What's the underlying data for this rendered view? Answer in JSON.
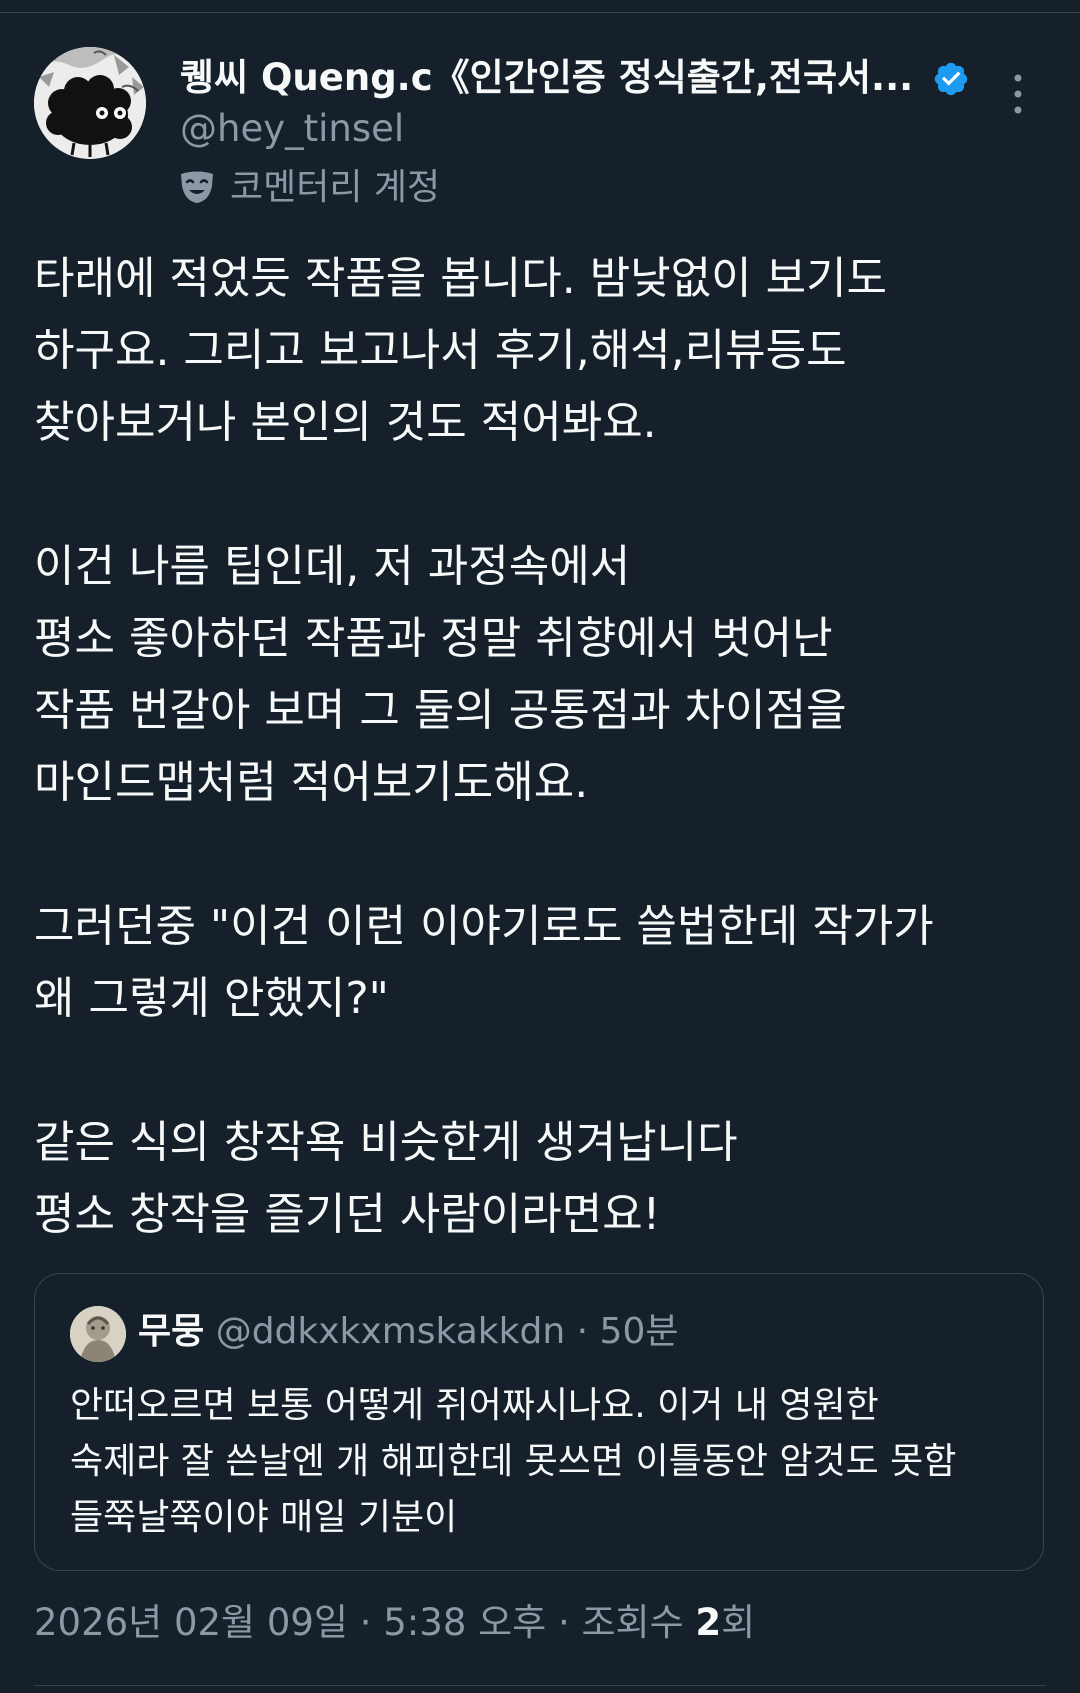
{
  "author": {
    "display_name": "퀭씨 Queng.c《인간인증 정식출간,전국서...",
    "handle": "@hey_tinsel",
    "account_label": "코멘터리 계정"
  },
  "tweet": {
    "lines": [
      "타래에 적었듯 작품을 봅니다. 밤낮없이 보기도",
      "하구요. 그리고 보고나서 후기,해석,리뷰등도",
      "찾아보거나 본인의 것도 적어봐요.",
      "",
      "이건 나름 팁인데, 저 과정속에서",
      "평소 좋아하던 작품과 정말 취향에서 벗어난",
      "작품 번갈아 보며 그 둘의 공통점과 차이점을",
      "마인드맵처럼 적어보기도해요.",
      "",
      "그러던중 \"이건 이런 이야기로도 쓸법한데 작가가",
      "왜 그렇게 안했지?\"",
      "",
      "같은 식의 창작욕 비슷한게 생겨납니다",
      "평소 창작을 즐기던 사람이라면요!"
    ]
  },
  "quote": {
    "name": "무뭉",
    "handle": "@ddkxkxmskakkdn",
    "separator": "·",
    "time": "50분",
    "lines": [
      "안떠오르면 보통 어떻게 쥐어짜시나요. 이거 내 영원한",
      "숙제라 잘 쓴날엔 개 해피한데 못쓰면 이틀동안 암것도 못함",
      "들쭉날쭉이야 매일 기분이"
    ]
  },
  "meta": {
    "date": "2026년 02월 09일",
    "separator": "·",
    "time": "5:38 오후",
    "views_label": "조회수",
    "views_count": "2",
    "views_suffix": "회"
  },
  "colors": {
    "background": "#15202b",
    "text": "#f7f9f9",
    "secondary_text": "#8b98a5",
    "border": "#38444d",
    "verified_blue": "#1d9bf0"
  },
  "icons": {
    "verified": "verified-badge-icon",
    "more": "more-vertical-icon",
    "commentary": "comedy-mask-icon"
  }
}
